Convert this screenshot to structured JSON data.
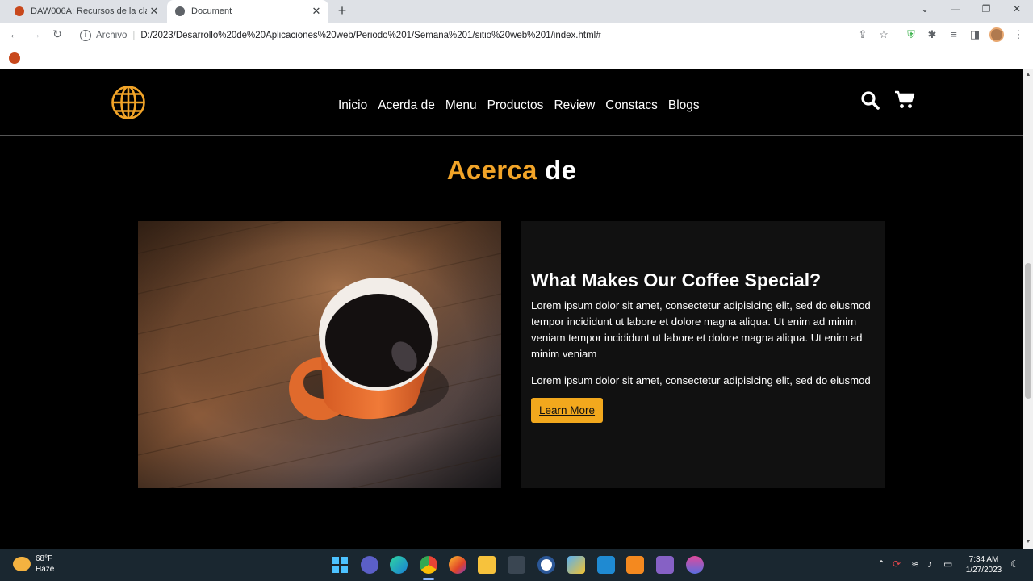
{
  "browser": {
    "tabs": [
      {
        "title": "DAW006A: Recursos de la clase",
        "close": "✕",
        "active": false
      },
      {
        "title": "Document",
        "close": "✕",
        "active": true
      }
    ],
    "new_tab": "+",
    "window_controls": {
      "expand": "⌄",
      "minimize": "—",
      "maximize": "❐",
      "close": "✕"
    },
    "nav": {
      "back": "←",
      "forward": "→",
      "reload": "↻"
    },
    "address": {
      "info": "i",
      "scheme_label": "Archivo",
      "separator": "|",
      "url": "D:/2023/Desarrollo%20de%20Aplicaciones%20web/Periodo%201/Semana%201/sitio%20web%201/index.html#"
    }
  },
  "site": {
    "nav_links": [
      "Inicio",
      "Acerda de",
      "Menu",
      "Productos",
      "Review",
      "Constacs",
      "Blogs"
    ],
    "section_title": {
      "accent": "Acerca",
      "rest": "de"
    },
    "about": {
      "heading": "What Makes Our Coffee Special?",
      "paragraph1": "Lorem ipsum dolor sit amet, consectetur adipisicing elit, sed do eiusmod tempor incididunt ut labore et dolore magna aliqua. Ut enim ad minim veniam tempor incididunt ut labore et dolore magna aliqua. Ut enim ad minim veniam",
      "paragraph2": "Lorem ipsum dolor sit amet, consectetur adipisicing elit, sed do eiusmod",
      "button": "Learn More"
    },
    "colors": {
      "accent": "#f2a428",
      "button": "#f2a81d",
      "background": "#000000",
      "card": "#111111"
    }
  },
  "taskbar": {
    "weather": {
      "temp": "68°F",
      "condition": "Haze"
    },
    "time": "7:34 AM",
    "date": "1/27/2023"
  }
}
